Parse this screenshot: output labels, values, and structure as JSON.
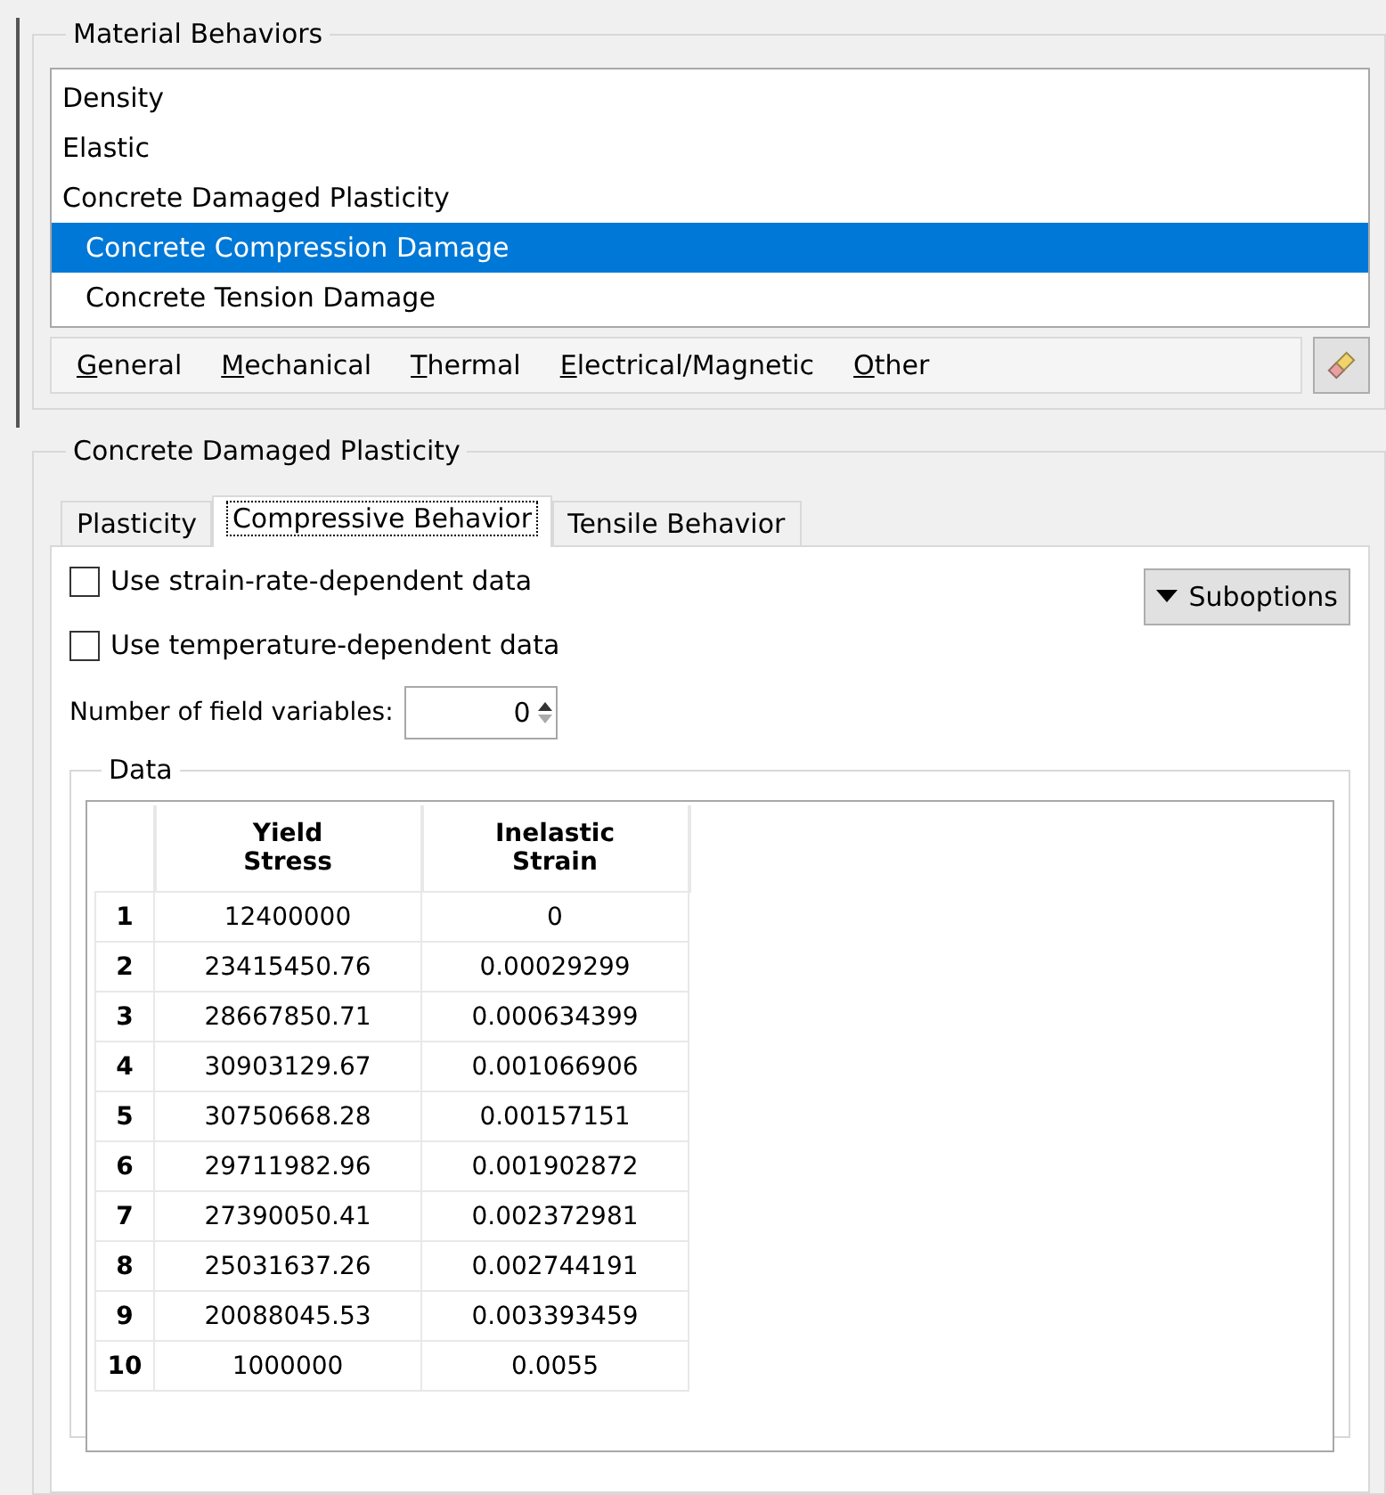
{
  "material_behaviors": {
    "title": "Material Behaviors",
    "items": [
      {
        "label": "Density",
        "selected": false
      },
      {
        "label": "Elastic",
        "selected": false
      },
      {
        "label": "Concrete Damaged Plasticity",
        "selected": false,
        "children": [
          {
            "label": "Concrete Compression Damage",
            "selected": true
          },
          {
            "label": "Concrete Tension Damage",
            "selected": false
          }
        ]
      }
    ],
    "menu": [
      "General",
      "Mechanical",
      "Thermal",
      "Electrical/Magnetic",
      "Other"
    ]
  },
  "section": {
    "title": "Concrete Damaged Plasticity",
    "tabs": [
      {
        "label": "Plasticity",
        "selected": false
      },
      {
        "label": "Compressive Behavior",
        "selected": true
      },
      {
        "label": "Tensile Behavior",
        "selected": false
      }
    ],
    "options": [
      {
        "label": "Use strain-rate-dependent data",
        "checked": false
      },
      {
        "label": "Use temperature-dependent data",
        "checked": false
      }
    ],
    "suboptions": "Suboptions",
    "field_variables": {
      "label": "Number of field variables:",
      "value": "0"
    },
    "data": {
      "title": "Data",
      "columns": [
        "",
        "Yield\nStress",
        "Inelastic\nStrain"
      ],
      "rows": [
        [
          "1",
          "12400000",
          "0"
        ],
        [
          "2",
          "23415450.76",
          "0.00029299"
        ],
        [
          "3",
          "28667850.71",
          "0.000634399"
        ],
        [
          "4",
          "30903129.67",
          "0.001066906"
        ],
        [
          "5",
          "30750668.28",
          "0.00157151"
        ],
        [
          "6",
          "29711982.96",
          "0.001902872"
        ],
        [
          "7",
          "27390050.41",
          "0.002372981"
        ],
        [
          "8",
          "25031637.26",
          "0.002744191"
        ],
        [
          "9",
          "20088045.53",
          "0.003393459"
        ],
        [
          "10",
          "1000000",
          "0.0055"
        ]
      ]
    }
  }
}
